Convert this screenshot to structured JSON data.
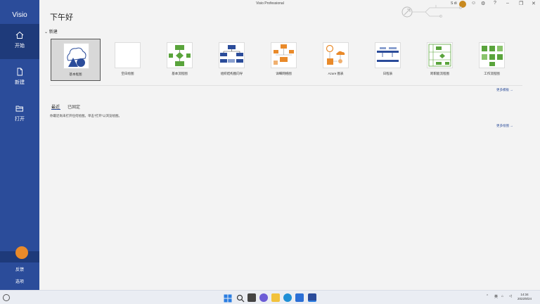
{
  "app": {
    "name": "Visio",
    "window_title": "Visio Professional",
    "user_short": "S di",
    "greeting": "下午好"
  },
  "sidebar": {
    "items": [
      {
        "label": "开始",
        "icon": "home-icon"
      },
      {
        "label": "新建",
        "icon": "new-file-icon"
      },
      {
        "label": "打开",
        "icon": "folder-open-icon"
      }
    ],
    "lower": [
      {
        "label": "反馈"
      },
      {
        "label": "选项"
      }
    ]
  },
  "new_section": {
    "heading": "新建",
    "templates": [
      {
        "label": "基本框图"
      },
      {
        "label": "空白绘图"
      },
      {
        "label": "基本流程图"
      },
      {
        "label": "组织结构图向导"
      },
      {
        "label": "详细网络图"
      },
      {
        "label": "Azure 图表"
      },
      {
        "label": "日程表"
      },
      {
        "label": "跨职能流程图"
      },
      {
        "label": "工作流程图"
      }
    ],
    "more_templates": "更多模板 →"
  },
  "recent": {
    "tabs": [
      {
        "label": "最近"
      },
      {
        "label": "已固定"
      }
    ],
    "empty_message": "你最近尚未打开任何绘图。单击“打开”以浏览绘图。",
    "more_files": "更多绘图 →"
  },
  "taskbar": {
    "tray_lang": "英",
    "time": "14:34",
    "date": "2022/8/24"
  },
  "colors": {
    "sidebar": "#2b4c9a",
    "accent": "#2b4c9a",
    "avatar": "#e98a2a"
  }
}
